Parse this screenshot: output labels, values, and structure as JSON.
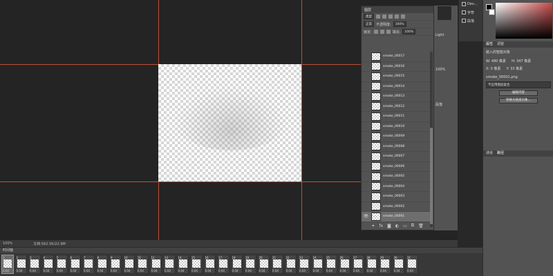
{
  "status": {
    "zoom": "100%",
    "doc": "文档:562.5K/22.9M"
  },
  "timeline": {
    "title": "时间轴",
    "menu_icon": "≡",
    "frames": [
      {
        "num": "1",
        "delay": "0.04"
      },
      {
        "num": "2",
        "delay": "0.04"
      },
      {
        "num": "3",
        "delay": "0.04"
      },
      {
        "num": "4",
        "delay": "0.04"
      },
      {
        "num": "5",
        "delay": "0.04"
      },
      {
        "num": "6",
        "delay": "0.04"
      },
      {
        "num": "7",
        "delay": "0.04"
      },
      {
        "num": "8",
        "delay": "0.04"
      },
      {
        "num": "9",
        "delay": "0.04"
      },
      {
        "num": "10",
        "delay": "0.04"
      },
      {
        "num": "11",
        "delay": "0.04"
      },
      {
        "num": "12",
        "delay": "0.04"
      },
      {
        "num": "13",
        "delay": "0.04"
      },
      {
        "num": "14",
        "delay": "0.04"
      },
      {
        "num": "15",
        "delay": "0.04"
      },
      {
        "num": "16",
        "delay": "0.04"
      },
      {
        "num": "17",
        "delay": "0.04"
      },
      {
        "num": "18",
        "delay": "0.04"
      },
      {
        "num": "19",
        "delay": "0.04"
      },
      {
        "num": "20",
        "delay": "0.04"
      },
      {
        "num": "21",
        "delay": "0.04"
      },
      {
        "num": "22",
        "delay": "0.04"
      },
      {
        "num": "23",
        "delay": "0.04"
      },
      {
        "num": "24",
        "delay": "0.04"
      },
      {
        "num": "25",
        "delay": "0.04"
      },
      {
        "num": "26",
        "delay": "0.04"
      },
      {
        "num": "27",
        "delay": "0.04"
      },
      {
        "num": "28",
        "delay": "0.04"
      },
      {
        "num": "29",
        "delay": "0.04"
      },
      {
        "num": "30",
        "delay": "0.04"
      },
      {
        "num": "31",
        "delay": "0.04"
      }
    ]
  },
  "layers_panel": {
    "title": "图层",
    "filter_kind": "类型",
    "blend_mode": "正常",
    "opacity_label": "不透明度:",
    "opacity_value": "100%",
    "lock_label": "锁定:",
    "fill_label": "填充:",
    "fill_value": "100%",
    "layers": [
      "smoke_00017",
      "smoke_00016",
      "smoke_00015",
      "smoke_00014",
      "smoke_00013",
      "smoke_00012",
      "smoke_00011",
      "smoke_00010",
      "smoke_00009",
      "smoke_00008",
      "smoke_00007",
      "smoke_00006",
      "smoke_00005",
      "smoke_00004",
      "smoke_00003",
      "smoke_00002",
      "smoke_00001"
    ],
    "selected_layer": "smoke_00001",
    "footer_fx": "fx"
  },
  "mid_panel": {
    "light": "Light",
    "zoom": "100%",
    "tab": "段落"
  },
  "dock": {
    "items": [
      "Dev...",
      "字符",
      "段落"
    ]
  },
  "properties": {
    "tabs": [
      "属性",
      "调整"
    ],
    "object_label": "嵌入的智能对象",
    "w": "W: 480 像素",
    "h": "H: 347 像素",
    "x": "X: 0 像素",
    "y": "Y: 33 像素",
    "filename": "smoke_00001.png",
    "comp_placeholder": "不应用图层复合",
    "edit_contents": "编辑内容",
    "convert_layers": "转换为链接对象..."
  },
  "paths": {
    "tabs": [
      "通道",
      "路径"
    ]
  }
}
